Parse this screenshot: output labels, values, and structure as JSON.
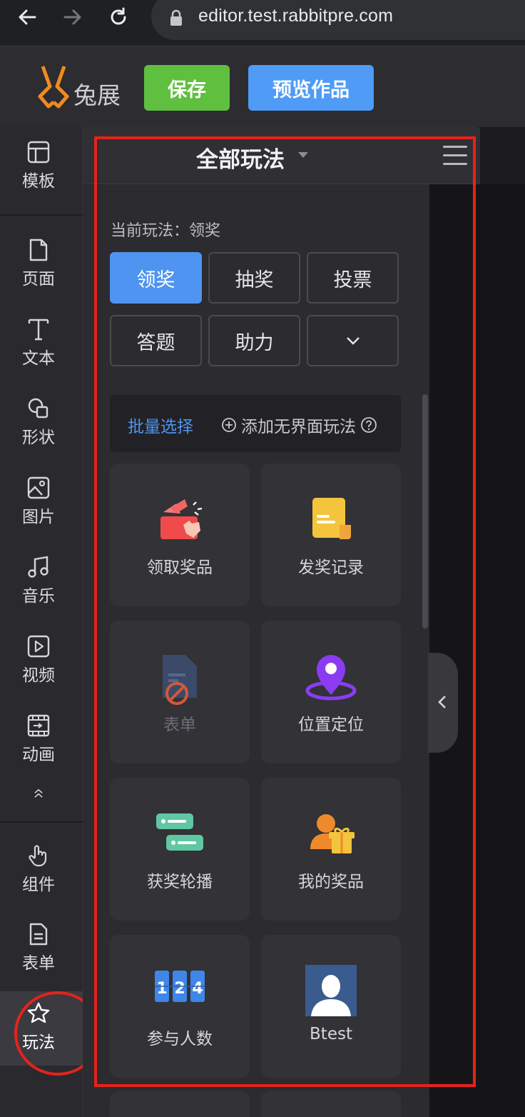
{
  "browser": {
    "url": "editor.test.rabbitpre.com"
  },
  "header": {
    "logo_text": "兔展",
    "save_label": "保存",
    "preview_label": "预览作品"
  },
  "toolbar": {
    "items": [
      {
        "label": "模板",
        "icon": "template-icon"
      },
      {
        "label": "页面",
        "icon": "page-icon"
      },
      {
        "label": "文本",
        "icon": "text-icon"
      },
      {
        "label": "形状",
        "icon": "shape-icon"
      },
      {
        "label": "图片",
        "icon": "image-icon"
      },
      {
        "label": "音乐",
        "icon": "music-icon"
      },
      {
        "label": "视频",
        "icon": "video-icon"
      },
      {
        "label": "动画",
        "icon": "animation-icon"
      },
      {
        "label": "组件",
        "icon": "hand-pointer-icon"
      },
      {
        "label": "表单",
        "icon": "form-icon"
      },
      {
        "label": "玩法",
        "icon": "star-icon"
      }
    ],
    "active": "玩法"
  },
  "panel": {
    "title": "全部玩法",
    "current_prefix": "当前玩法：领奖",
    "modes": [
      "领奖",
      "抽奖",
      "投票",
      "答题",
      "助力"
    ],
    "active_mode": "领奖",
    "batch_select": "批量选择",
    "add_headless": "添加无界面玩法",
    "cards": [
      {
        "label": "领取奖品",
        "icon": "gift-claim-icon",
        "disabled": false
      },
      {
        "label": "发奖记录",
        "icon": "record-doc-icon",
        "disabled": false
      },
      {
        "label": "表单",
        "icon": "form-disabled-icon",
        "disabled": true
      },
      {
        "label": "位置定位",
        "icon": "location-pin-icon",
        "disabled": false
      },
      {
        "label": "获奖轮播",
        "icon": "carousel-icon",
        "disabled": false
      },
      {
        "label": "我的奖品",
        "icon": "my-prize-icon",
        "disabled": false
      },
      {
        "label": "参与人数",
        "icon": "counter-icon",
        "disabled": false
      },
      {
        "label": "Btest",
        "icon": "avatar-icon",
        "disabled": false
      }
    ]
  },
  "colors": {
    "accent_blue": "#4f94f0",
    "save_green": "#5fbf3f",
    "annotation_red": "#e5231b"
  }
}
